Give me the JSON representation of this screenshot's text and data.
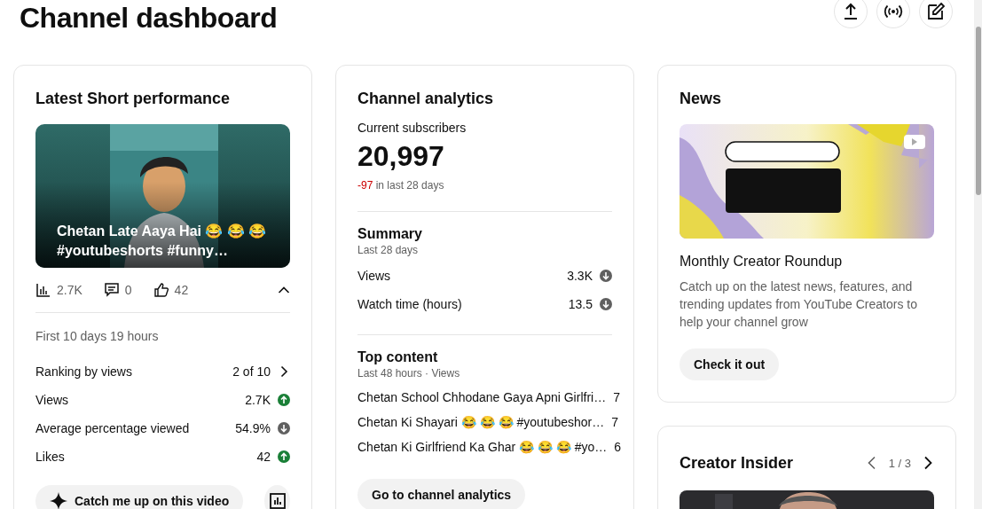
{
  "header": {
    "title": "Channel dashboard",
    "actions": [
      {
        "kind": "upload"
      },
      {
        "kind": "live"
      },
      {
        "kind": "edit"
      }
    ]
  },
  "latest_short": {
    "title": "Latest Short performance",
    "video_title": "Chetan Late Aaya Hai 😂 😂 😂 #youtubeshorts #funny…",
    "stats": [
      {
        "kind": "views",
        "value": "2.7K"
      },
      {
        "kind": "comments",
        "value": "0"
      },
      {
        "kind": "likes",
        "value": "42"
      }
    ],
    "expanded": true,
    "period": "First 10 days 19 hours",
    "metrics": [
      {
        "label": "Ranking by views",
        "value": "2 of 10",
        "kind": "more"
      },
      {
        "label": "Views",
        "value": "2.7K",
        "kind": "up"
      },
      {
        "label": "Average percentage viewed",
        "value": "54.9%",
        "kind": "down"
      },
      {
        "label": "Likes",
        "value": "42",
        "kind": "up"
      }
    ],
    "catch_up_button": "Catch me up on this video"
  },
  "channel_analytics": {
    "title": "Channel analytics",
    "subscribers_label": "Current subscribers",
    "subscribers": "20,997",
    "change": "-97",
    "change_suffix": "in last 28 days",
    "summary": {
      "title": "Summary",
      "period": "Last 28 days",
      "metrics": [
        {
          "label": "Views",
          "value": "3.3K",
          "kind": "down"
        },
        {
          "label": "Watch time (hours)",
          "value": "13.5",
          "kind": "down"
        }
      ]
    },
    "top_content": {
      "title": "Top content",
      "period": "Last 48 hours · Views",
      "items": [
        {
          "title": "Chetan School Chhodane Gaya Apni Girlfri…",
          "value": "7"
        },
        {
          "title": "Chetan Ki Shayari 😂 😂 😂 #youtubeshor…",
          "value": "7"
        },
        {
          "title": "Chetan Ki Girlfriend Ka Ghar 😂 😂 😂 #yo…",
          "value": "6"
        }
      ]
    },
    "button": "Go to channel analytics"
  },
  "news": {
    "title": "News",
    "item_title": "Monthly Creator Roundup",
    "description": "Catch up on the latest news, features, and trending updates from YouTube Creators to help your channel grow",
    "button": "Check it out"
  },
  "creator_insider": {
    "title": "Creator Insider",
    "pager": "1 / 3"
  }
}
